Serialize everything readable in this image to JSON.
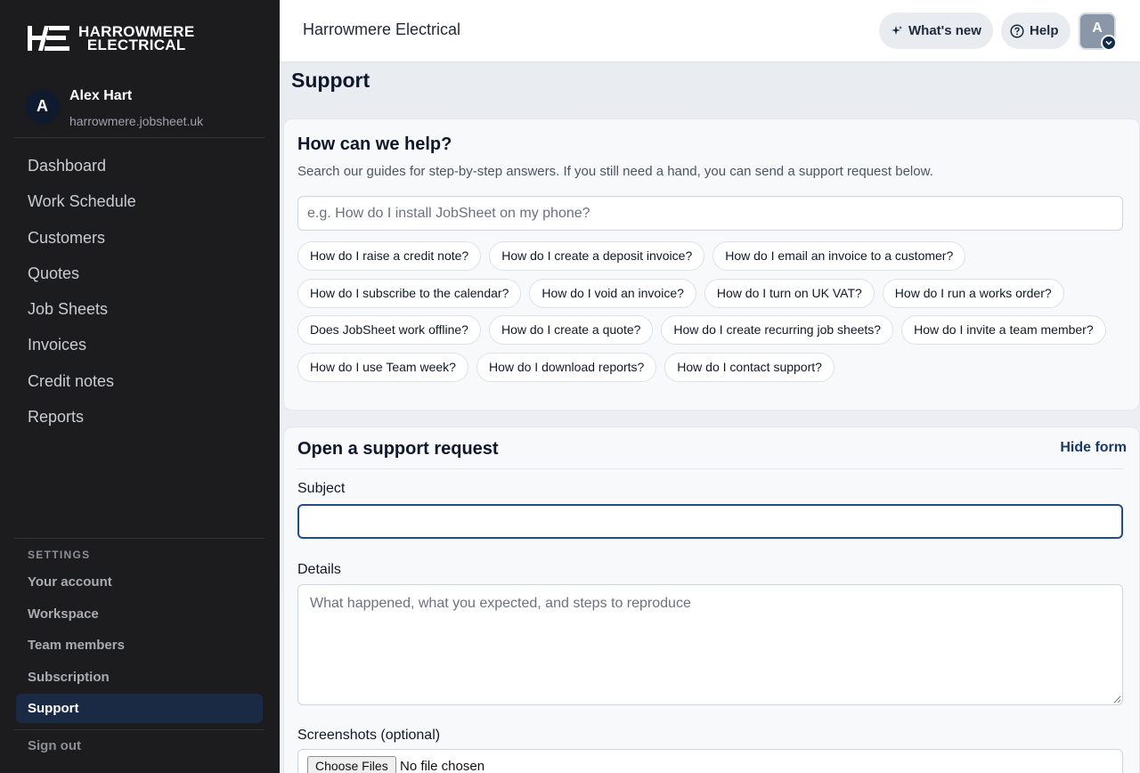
{
  "brand": {
    "logo_mark": "HE",
    "logo_line1": "HARROWMERE",
    "logo_line2": "ELECTRICAL"
  },
  "user": {
    "initial": "A",
    "name": "Alex Hart",
    "domain": "harrowmere.jobsheet.uk"
  },
  "nav": {
    "items": [
      "Dashboard",
      "Work Schedule",
      "Customers",
      "Quotes",
      "Job Sheets",
      "Invoices",
      "Credit notes",
      "Reports"
    ]
  },
  "settings": {
    "label": "SETTINGS",
    "items": [
      "Your account",
      "Workspace",
      "Team members",
      "Subscription",
      "Support"
    ],
    "active": "Support"
  },
  "sign_out": "Sign out",
  "topbar": {
    "title": "Harrowmere Electrical",
    "whats_new": "What's new",
    "help": "Help",
    "avatar_initial": "A"
  },
  "page": {
    "title": "Support"
  },
  "help_card": {
    "title": "How can we help?",
    "subtitle": "Search our guides for step-by-step answers. If you still need a hand, you can send a support request below.",
    "search_placeholder": "e.g. How do I install JobSheet on my phone?",
    "chips": [
      [
        "How do I raise a credit note?",
        "How do I create a deposit invoice?",
        "How do I email an invoice to a customer?"
      ],
      [
        "How do I subscribe to the calendar?",
        "How do I void an invoice?",
        "How do I turn on UK VAT?",
        "How do I run a works order?"
      ],
      [
        "Does JobSheet work offline?",
        "How do I create a quote?",
        "How do I create recurring job sheets?",
        "How do I invite a team member?"
      ],
      [
        "How do I use Team week?",
        "How do I download reports?",
        "How do I contact support?"
      ]
    ]
  },
  "request_card": {
    "title": "Open a support request",
    "hide_form": "Hide form",
    "subject_label": "Subject",
    "subject_value": "",
    "details_label": "Details",
    "details_placeholder": "What happened, what you expected, and steps to reproduce",
    "screenshots_label": "Screenshots (optional)",
    "choose_files": "Choose Files",
    "file_status": "No file chosen"
  },
  "colors": {
    "sidebar_bg": "#1c1c1e",
    "active_item_bg": "#1b2a44",
    "accent": "#1d4e89"
  }
}
